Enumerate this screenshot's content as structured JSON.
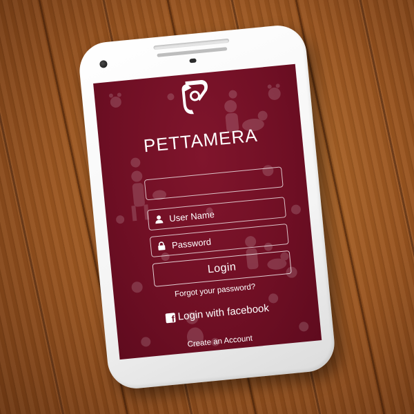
{
  "app": {
    "brand_name": "PETTAMERA"
  },
  "login_form": {
    "username_placeholder": "User Name",
    "password_placeholder": "Password",
    "login_label": "Login",
    "forgot_password_link": "Forgot your password?",
    "facebook_login_label": "Login with facebook",
    "create_account_link": "Create an Account"
  },
  "icons": {
    "user": "user-icon",
    "lock": "lock-icon",
    "facebook": "facebook-icon",
    "logo": "pettamera-logo-icon"
  },
  "colors": {
    "screen_background": "#6f0f24",
    "text": "#ffffff",
    "phone_body": "#f4f4f4",
    "wood_background": "#9a5520"
  }
}
